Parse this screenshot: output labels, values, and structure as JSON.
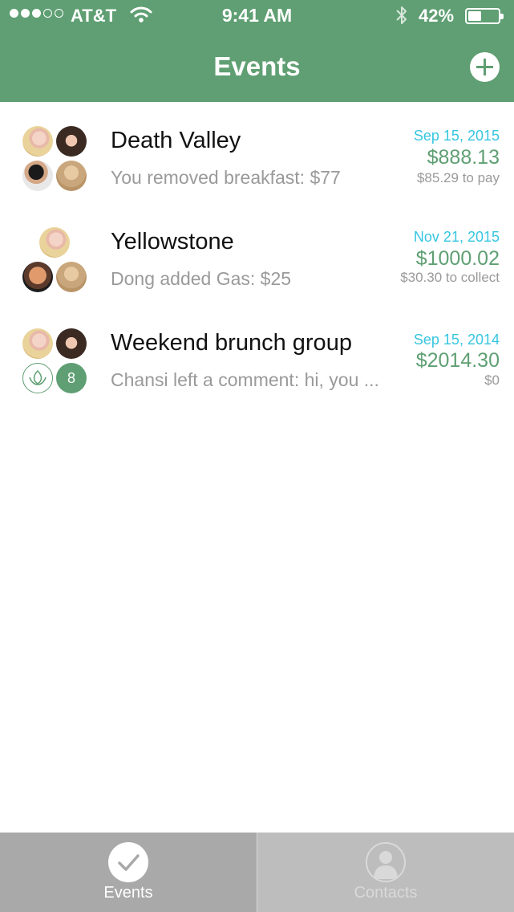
{
  "status_bar": {
    "carrier": "AT&T",
    "time": "9:41 AM",
    "battery": "42%",
    "signal_bars_filled": 3,
    "signal_bars_total": 5
  },
  "header": {
    "title": "Events",
    "add_icon": "plus-circle-icon"
  },
  "events": [
    {
      "name": "Death Valley",
      "last_activity": "You removed breakfast: $77",
      "date": "Sep 15, 2015",
      "amount": "$888.13",
      "balance": "$85.29 to pay"
    },
    {
      "name": "Yellowstone",
      "last_activity": "Dong added Gas: $25",
      "date": "Nov 21, 2015",
      "amount": "$1000.02",
      "balance": "$30.30 to collect"
    },
    {
      "name": "Weekend brunch group",
      "last_activity": "Chansi left a comment: hi, you ...",
      "date": "Sep 15, 2014",
      "amount": "$2014.30",
      "balance": "$0",
      "extra_members": "8"
    }
  ],
  "tabs": [
    {
      "label": "Events",
      "icon": "checkmark-icon",
      "active": true
    },
    {
      "label": "Contacts",
      "icon": "person-icon",
      "active": false
    }
  ],
  "colors": {
    "brand_green": "#5f9f73",
    "date_blue": "#36c6e0",
    "muted_gray": "#9a9a9a"
  }
}
